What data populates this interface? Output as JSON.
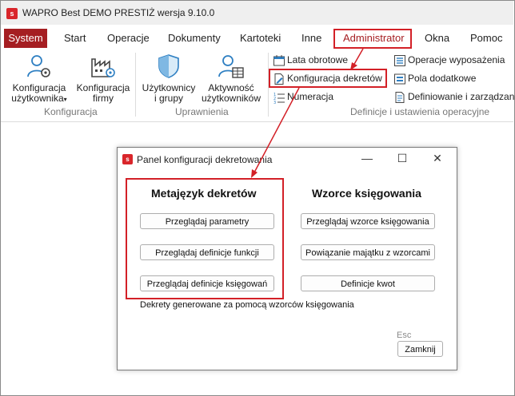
{
  "app": {
    "logo_letter": "s",
    "title": "WAPRO Best DEMO PRESTIŻ wersja 9.10.0"
  },
  "menu": [
    {
      "label": "System"
    },
    {
      "label": "Start"
    },
    {
      "label": "Operacje"
    },
    {
      "label": "Dokumenty"
    },
    {
      "label": "Kartoteki"
    },
    {
      "label": "Inne"
    },
    {
      "label": "Administrator"
    },
    {
      "label": "Okna"
    },
    {
      "label": "Pomoc"
    }
  ],
  "ribbon": {
    "konfiguracja_group": "Konfiguracja",
    "uprawnienia_group": "Uprawnienia",
    "definicje_group": "Definicje i ustawienia operacyjne",
    "konf_uzytkownika": [
      "Konfiguracja",
      "użytkownika"
    ],
    "konf_firmy": [
      "Konfiguracja",
      "firmy"
    ],
    "uzytkownicy": [
      "Użytkownicy",
      "i grupy"
    ],
    "aktywnosc": [
      "Aktywność",
      "użytkowników"
    ],
    "lata": "Lata obrotowe",
    "konf_dekretow": "Konfiguracja dekretów",
    "numeracja": "Numeracja",
    "operacje_wyp": "Operacje wyposażenia",
    "pola": "Pola dodatkowe",
    "definiowanie": "Definiowanie i zarządzan"
  },
  "dialog": {
    "logo_letter": "s",
    "title": "Panel konfiguracji dekretowania",
    "controls": {
      "minimize": "—",
      "maximize": "☐",
      "close": "✕"
    },
    "left_title": "Metajęzyk dekretów",
    "right_title": "Wzorce księgowania",
    "left_buttons": [
      "Przeglądaj parametry",
      "Przeglądaj definicje funkcji",
      "Przeglądaj definicje księgowań"
    ],
    "right_buttons": [
      "Przeglądaj wzorce księgowania",
      "Powiązanie majątku z wzorcami",
      "Definicje kwot"
    ],
    "note": "Dekrety generowane za pomocą wzorców księgowania",
    "esc": "Esc",
    "close_button": "Zamknij"
  },
  "colors": {
    "brand": "#a51e22",
    "highlight": "#d32027",
    "icon_blue": "#2e7fc2"
  }
}
